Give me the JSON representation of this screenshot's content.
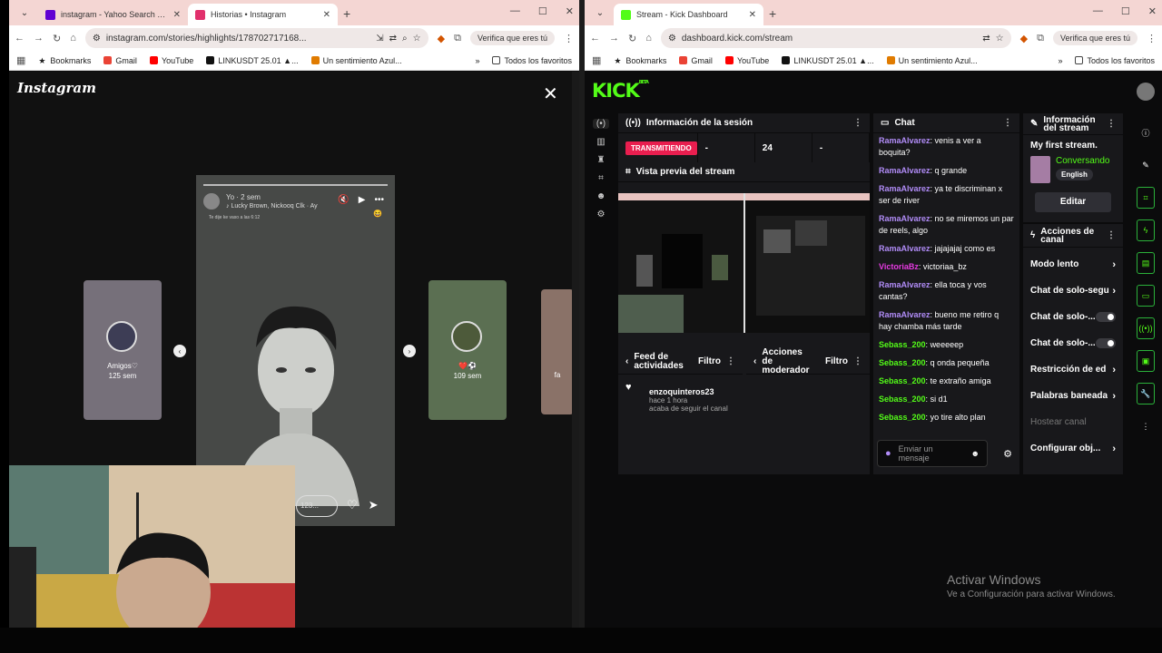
{
  "left_browser": {
    "tabs": [
      {
        "title": "instagram - Yahoo Search Tus r",
        "favicon_color": "#6001d2",
        "active": false
      },
      {
        "title": "Historias • Instagram",
        "favicon_color": "#e1306c",
        "active": true
      }
    ],
    "url": "instagram.com/stories/highlights/178702717168...",
    "verify_label": "Verifica que eres tú",
    "bookmarks": [
      "Bookmarks",
      "Gmail",
      "YouTube",
      "LINKUSDT 25.01 ▲...",
      "Un sentimiento Azul..."
    ],
    "bookmarks_right": [
      "»",
      "Todos los favoritos"
    ]
  },
  "instagram": {
    "logo": "Instagram",
    "story": {
      "username": "Yo",
      "time": "2 sem",
      "music": "Lucky Brown, Nickooq Clk · Ay",
      "caption": "Te dije ke vaso a las 6:12",
      "emoji": "😆",
      "reply_placeholder": "123..."
    },
    "side_left": {
      "name": "Amigos♡",
      "age": "125 sem"
    },
    "side_right": {
      "name": "❤️⚽",
      "age": "109 sem"
    },
    "side_far": {
      "name": "fa"
    }
  },
  "right_browser": {
    "tabs": [
      {
        "title": "Stream - Kick Dashboard",
        "favicon_color": "#53fc18",
        "active": true
      }
    ],
    "url": "dashboard.kick.com/stream",
    "verify_label": "Verifica que eres tú",
    "bookmarks": [
      "Bookmarks",
      "Gmail",
      "YouTube",
      "LINKUSDT 25.01 ▲...",
      "Un sentimiento Azul..."
    ],
    "bookmarks_right": [
      "»",
      "Todos los favoritos"
    ]
  },
  "kick": {
    "logo": "KICK",
    "logo_badge": "BETA",
    "session": {
      "title": "Información de la sesión",
      "status": "TRANSMITIENDO",
      "cells": [
        "-",
        "24",
        "-"
      ]
    },
    "preview_title": "Vista previa del stream",
    "feed": {
      "title": "Feed de actividades",
      "filter": "Filtro",
      "user": "enzoquinteros23",
      "time": "hace 1 hora",
      "action": "acaba de seguir el canal"
    },
    "mod": {
      "title": "Acciones de moderador",
      "filter": "Filtro"
    },
    "chat": {
      "title": "Chat",
      "messages": [
        {
          "user": "RamaAlvarez",
          "text": "venis a ver a boquita?",
          "color": "purple"
        },
        {
          "user": "RamaAlvarez",
          "text": "q grande",
          "color": "purple"
        },
        {
          "user": "RamaAlvarez",
          "text": "ya te discriminan x ser de river",
          "color": "purple"
        },
        {
          "user": "RamaAlvarez",
          "text": "no se miremos un par de reels, algo",
          "color": "purple"
        },
        {
          "user": "RamaAlvarez",
          "text": "jajajajaj como es",
          "color": "purple"
        },
        {
          "user": "VictoriaBz",
          "text": "victoriaa_bz",
          "color": "pink"
        },
        {
          "user": "RamaAlvarez",
          "text": "ella toca y vos cantas?",
          "color": "purple"
        },
        {
          "user": "RamaAlvarez",
          "text": "bueno me retiro q hay chamba más tarde",
          "color": "purple"
        },
        {
          "user": "Sebass_200",
          "text": "weeeeep",
          "color": "green"
        },
        {
          "user": "Sebass_200",
          "text": "q onda pequeña",
          "color": "green"
        },
        {
          "user": "Sebass_200",
          "text": "te extraño amiga",
          "color": "green"
        },
        {
          "user": "Sebass_200",
          "text": "si d1",
          "color": "green"
        },
        {
          "user": "Sebass_200",
          "text": "yo tire alto plan",
          "color": "green"
        }
      ],
      "input_placeholder": "Enviar un mensaje"
    },
    "stream_info": {
      "title": "Información del stream",
      "stream_title": "My first stream.",
      "category": "Conversando",
      "language": "English",
      "edit": "Editar"
    },
    "channel_actions": {
      "title": "Acciones de canal",
      "items": [
        {
          "label": "Modo lento",
          "kind": "arrow"
        },
        {
          "label": "Chat de solo-segu",
          "kind": "arrow"
        },
        {
          "label": "Chat de solo-...",
          "kind": "toggle"
        },
        {
          "label": "Chat de solo-...",
          "kind": "toggle"
        },
        {
          "label": "Restricción de ed",
          "kind": "arrow"
        },
        {
          "label": "Palabras baneada",
          "kind": "arrow"
        },
        {
          "label": "Hostear canal",
          "kind": "dim"
        },
        {
          "label": "Configurar obj...",
          "kind": "arrow"
        }
      ]
    },
    "activate": {
      "line1": "Activar Windows",
      "line2": "Ve a Configuración para activar Windows."
    }
  },
  "colors": {
    "kick_green": "#53fc18",
    "live_red": "#e91e4f",
    "tab_bg": "#f4d6d3"
  }
}
